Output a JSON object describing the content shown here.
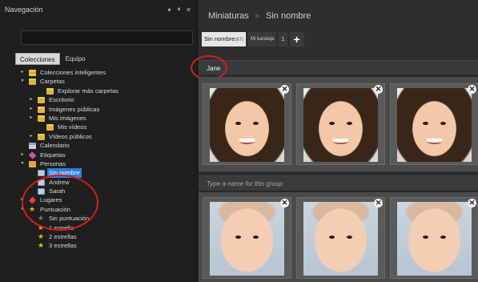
{
  "navigation": {
    "title": "Navegación",
    "controls": [
      "▾",
      "⏸",
      "✕"
    ],
    "tabs": [
      {
        "label": "Colecciones",
        "active": true
      },
      {
        "label": "Equipo",
        "active": false
      }
    ],
    "tree": [
      {
        "label": "Colecciones inteligentes",
        "level": 0,
        "arrow": "▸",
        "icon": "smart-collections-icon"
      },
      {
        "label": "Carpetas",
        "level": 0,
        "arrow": "▾",
        "icon": "folder-icon"
      },
      {
        "label": "Explorar más carpetas",
        "level": 2,
        "arrow": "",
        "icon": "folder-icon"
      },
      {
        "label": "Escritorio",
        "level": 1,
        "arrow": "▸",
        "icon": "folder-icon"
      },
      {
        "label": "Imágenes públicas",
        "level": 1,
        "arrow": "▸",
        "icon": "folder-icon"
      },
      {
        "label": "Mis imágenes",
        "level": 1,
        "arrow": "▸",
        "icon": "folder-icon"
      },
      {
        "label": "Mis vídeos",
        "level": 2,
        "arrow": "",
        "icon": "folder-icon"
      },
      {
        "label": "Vídeos públicos",
        "level": 1,
        "arrow": "▸",
        "icon": "folder-icon"
      },
      {
        "label": "Calendario",
        "level": 0,
        "arrow": "",
        "icon": "calendar-icon"
      },
      {
        "label": "Etiquetas",
        "level": 0,
        "arrow": "▸",
        "icon": "tag-icon"
      },
      {
        "label": "Personas",
        "level": 0,
        "arrow": "▾",
        "icon": "people-icon"
      },
      {
        "label": "Sin nombre",
        "level": 1,
        "arrow": "",
        "icon": "person-icon",
        "selected": true
      },
      {
        "label": "Andrew",
        "level": 1,
        "arrow": "",
        "icon": "person-icon"
      },
      {
        "label": "Sarah",
        "level": 1,
        "arrow": "",
        "icon": "person-icon"
      },
      {
        "label": "Lugares",
        "level": 0,
        "arrow": "▸",
        "icon": "pin-icon"
      },
      {
        "label": "Puntuación",
        "level": 0,
        "arrow": "▾",
        "icon": "star-icon"
      },
      {
        "label": "Sin puntuación",
        "level": 1,
        "arrow": "",
        "icon": "star-empty-icon"
      },
      {
        "label": "1 estrella",
        "level": 1,
        "arrow": "",
        "icon": "star-icon"
      },
      {
        "label": "2 estrellas",
        "level": 1,
        "arrow": "",
        "icon": "star-icon"
      },
      {
        "label": "3 estrellas",
        "level": 1,
        "arrow": "",
        "icon": "star-icon"
      }
    ]
  },
  "main": {
    "breadcrumb": [
      "Miniaturas",
      "Sin nombre"
    ],
    "breadcrumb_separator": ">",
    "tabs": [
      {
        "label": "Sin nombre",
        "count": "(67)",
        "active": true
      },
      {
        "label": "Mi bandeja",
        "active": false
      },
      {
        "label": "1",
        "active": false
      },
      {
        "label": "+",
        "active": false
      }
    ],
    "group1_name": "Jane",
    "group2_placeholder": "Type a name for this group",
    "close_glyph": "✕"
  },
  "colors": {
    "accent": "#2f7de0",
    "annotation": "#d61b1b",
    "star": "#f5b400"
  }
}
